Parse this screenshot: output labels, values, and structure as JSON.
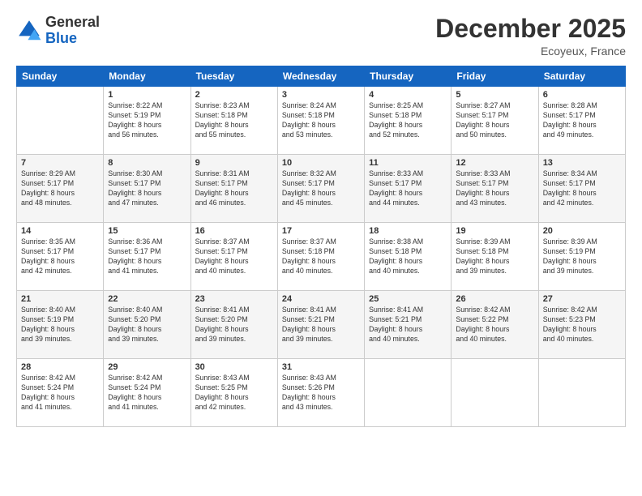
{
  "logo": {
    "line1": "General",
    "line2": "Blue"
  },
  "title": "December 2025",
  "location": "Ecoyeux, France",
  "weekdays": [
    "Sunday",
    "Monday",
    "Tuesday",
    "Wednesday",
    "Thursday",
    "Friday",
    "Saturday"
  ],
  "weeks": [
    [
      {
        "day": "",
        "info": ""
      },
      {
        "day": "1",
        "info": "Sunrise: 8:22 AM\nSunset: 5:19 PM\nDaylight: 8 hours\nand 56 minutes."
      },
      {
        "day": "2",
        "info": "Sunrise: 8:23 AM\nSunset: 5:18 PM\nDaylight: 8 hours\nand 55 minutes."
      },
      {
        "day": "3",
        "info": "Sunrise: 8:24 AM\nSunset: 5:18 PM\nDaylight: 8 hours\nand 53 minutes."
      },
      {
        "day": "4",
        "info": "Sunrise: 8:25 AM\nSunset: 5:18 PM\nDaylight: 8 hours\nand 52 minutes."
      },
      {
        "day": "5",
        "info": "Sunrise: 8:27 AM\nSunset: 5:17 PM\nDaylight: 8 hours\nand 50 minutes."
      },
      {
        "day": "6",
        "info": "Sunrise: 8:28 AM\nSunset: 5:17 PM\nDaylight: 8 hours\nand 49 minutes."
      }
    ],
    [
      {
        "day": "7",
        "info": "Sunrise: 8:29 AM\nSunset: 5:17 PM\nDaylight: 8 hours\nand 48 minutes."
      },
      {
        "day": "8",
        "info": "Sunrise: 8:30 AM\nSunset: 5:17 PM\nDaylight: 8 hours\nand 47 minutes."
      },
      {
        "day": "9",
        "info": "Sunrise: 8:31 AM\nSunset: 5:17 PM\nDaylight: 8 hours\nand 46 minutes."
      },
      {
        "day": "10",
        "info": "Sunrise: 8:32 AM\nSunset: 5:17 PM\nDaylight: 8 hours\nand 45 minutes."
      },
      {
        "day": "11",
        "info": "Sunrise: 8:33 AM\nSunset: 5:17 PM\nDaylight: 8 hours\nand 44 minutes."
      },
      {
        "day": "12",
        "info": "Sunrise: 8:33 AM\nSunset: 5:17 PM\nDaylight: 8 hours\nand 43 minutes."
      },
      {
        "day": "13",
        "info": "Sunrise: 8:34 AM\nSunset: 5:17 PM\nDaylight: 8 hours\nand 42 minutes."
      }
    ],
    [
      {
        "day": "14",
        "info": "Sunrise: 8:35 AM\nSunset: 5:17 PM\nDaylight: 8 hours\nand 42 minutes."
      },
      {
        "day": "15",
        "info": "Sunrise: 8:36 AM\nSunset: 5:17 PM\nDaylight: 8 hours\nand 41 minutes."
      },
      {
        "day": "16",
        "info": "Sunrise: 8:37 AM\nSunset: 5:17 PM\nDaylight: 8 hours\nand 40 minutes."
      },
      {
        "day": "17",
        "info": "Sunrise: 8:37 AM\nSunset: 5:18 PM\nDaylight: 8 hours\nand 40 minutes."
      },
      {
        "day": "18",
        "info": "Sunrise: 8:38 AM\nSunset: 5:18 PM\nDaylight: 8 hours\nand 40 minutes."
      },
      {
        "day": "19",
        "info": "Sunrise: 8:39 AM\nSunset: 5:18 PM\nDaylight: 8 hours\nand 39 minutes."
      },
      {
        "day": "20",
        "info": "Sunrise: 8:39 AM\nSunset: 5:19 PM\nDaylight: 8 hours\nand 39 minutes."
      }
    ],
    [
      {
        "day": "21",
        "info": "Sunrise: 8:40 AM\nSunset: 5:19 PM\nDaylight: 8 hours\nand 39 minutes."
      },
      {
        "day": "22",
        "info": "Sunrise: 8:40 AM\nSunset: 5:20 PM\nDaylight: 8 hours\nand 39 minutes."
      },
      {
        "day": "23",
        "info": "Sunrise: 8:41 AM\nSunset: 5:20 PM\nDaylight: 8 hours\nand 39 minutes."
      },
      {
        "day": "24",
        "info": "Sunrise: 8:41 AM\nSunset: 5:21 PM\nDaylight: 8 hours\nand 39 minutes."
      },
      {
        "day": "25",
        "info": "Sunrise: 8:41 AM\nSunset: 5:21 PM\nDaylight: 8 hours\nand 40 minutes."
      },
      {
        "day": "26",
        "info": "Sunrise: 8:42 AM\nSunset: 5:22 PM\nDaylight: 8 hours\nand 40 minutes."
      },
      {
        "day": "27",
        "info": "Sunrise: 8:42 AM\nSunset: 5:23 PM\nDaylight: 8 hours\nand 40 minutes."
      }
    ],
    [
      {
        "day": "28",
        "info": "Sunrise: 8:42 AM\nSunset: 5:24 PM\nDaylight: 8 hours\nand 41 minutes."
      },
      {
        "day": "29",
        "info": "Sunrise: 8:42 AM\nSunset: 5:24 PM\nDaylight: 8 hours\nand 41 minutes."
      },
      {
        "day": "30",
        "info": "Sunrise: 8:43 AM\nSunset: 5:25 PM\nDaylight: 8 hours\nand 42 minutes."
      },
      {
        "day": "31",
        "info": "Sunrise: 8:43 AM\nSunset: 5:26 PM\nDaylight: 8 hours\nand 43 minutes."
      },
      {
        "day": "",
        "info": ""
      },
      {
        "day": "",
        "info": ""
      },
      {
        "day": "",
        "info": ""
      }
    ]
  ]
}
